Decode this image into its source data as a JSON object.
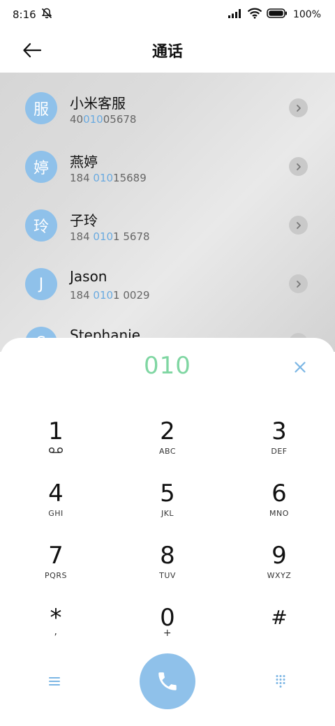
{
  "status_bar": {
    "time": "8:16",
    "battery": "100%"
  },
  "header": {
    "title": "通话"
  },
  "contacts": [
    {
      "avatar": "服",
      "name": "小米客服",
      "number_parts": [
        "40",
        "010",
        "05678"
      ]
    },
    {
      "avatar": "婷",
      "name": "燕婷",
      "number_parts": [
        "184 ",
        "010",
        "15689"
      ]
    },
    {
      "avatar": "玲",
      "name": "子玲",
      "number_parts": [
        "184 ",
        "010",
        "1 5678"
      ]
    },
    {
      "avatar": "J",
      "name": "Jason",
      "number_parts": [
        "184 ",
        "010",
        "1 0029"
      ]
    },
    {
      "avatar": "S",
      "name": "Stephanie",
      "number_parts": [
        "",
        "",
        ""
      ]
    }
  ],
  "dialpad": {
    "dialed": "010",
    "keys": [
      {
        "digit": "1",
        "sub": ""
      },
      {
        "digit": "2",
        "sub": "ABC"
      },
      {
        "digit": "3",
        "sub": "DEF"
      },
      {
        "digit": "4",
        "sub": "GHI"
      },
      {
        "digit": "5",
        "sub": "JKL"
      },
      {
        "digit": "6",
        "sub": "MNO"
      },
      {
        "digit": "7",
        "sub": "PQRS"
      },
      {
        "digit": "8",
        "sub": "TUV"
      },
      {
        "digit": "9",
        "sub": "WXYZ"
      },
      {
        "digit": "*",
        "sub": ","
      },
      {
        "digit": "0",
        "sub": "+"
      },
      {
        "digit": "#",
        "sub": ""
      }
    ]
  },
  "icons": {
    "mute": "bell-off-icon",
    "signal": "signal-icon",
    "wifi": "wifi-icon",
    "battery": "battery-icon",
    "back": "back-arrow-icon",
    "detail": "chevron-right-icon",
    "clear": "close-icon",
    "voicemail": "voicemail-icon",
    "menu": "menu-icon",
    "call": "phone-icon",
    "keypad": "dialpad-icon"
  },
  "colors": {
    "accent": "#8fc1ea",
    "dialed": "#7fd6a2",
    "match": "#6aaae0"
  }
}
